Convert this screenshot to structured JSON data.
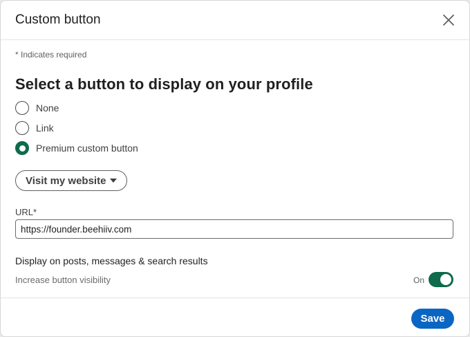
{
  "dialog": {
    "title": "Custom button",
    "required_note": "* Indicates required"
  },
  "button_select": {
    "heading": "Select a button to display on your profile",
    "options": [
      {
        "label": "None",
        "checked": false
      },
      {
        "label": "Link",
        "checked": false
      },
      {
        "label": "Premium custom button",
        "checked": true
      }
    ],
    "dropdown": {
      "selected": "Visit my website",
      "icon": "caret-down-icon"
    }
  },
  "url_field": {
    "label": "URL*",
    "value": "https://founder.beehiiv.com"
  },
  "display_settings": {
    "heading": "Display on posts, messages & search results",
    "visibility_label": "Increase button visibility",
    "toggle_status": "On",
    "toggle_on": true
  },
  "footer": {
    "save_label": "Save"
  },
  "colors": {
    "accent_green": "#0e6b4b",
    "primary_blue": "#0a66c2"
  },
  "icons": {
    "close": "close-icon"
  }
}
